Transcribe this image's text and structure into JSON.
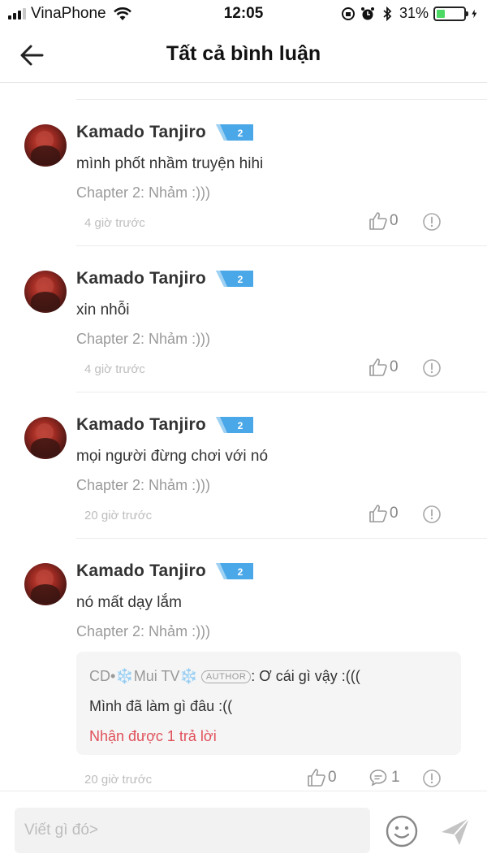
{
  "status_bar": {
    "carrier": "VinaPhone",
    "time": "12:05",
    "battery_percent": "31%",
    "battery_level": 0.31,
    "battery_color": "#4cd964"
  },
  "nav": {
    "back_icon": "arrow-left-icon",
    "title": "Tất cả bình luận"
  },
  "comments": [
    {
      "author": "Kamado Tanjiro",
      "level": "2",
      "text": "mình phốt nhầm truyện hihi",
      "chapter": "Chapter 2: Nhảm :)))",
      "time": "4 giờ trước",
      "likes": "0"
    },
    {
      "author": "Kamado Tanjiro",
      "level": "2",
      "text": "xin nhỗi",
      "chapter": "Chapter 2: Nhảm :)))",
      "time": "4 giờ trước",
      "likes": "0"
    },
    {
      "author": "Kamado Tanjiro",
      "level": "2",
      "text": "mọi người đừng chơi với nó",
      "chapter": "Chapter 2: Nhảm :)))",
      "time": "20 giờ trước",
      "likes": "0"
    },
    {
      "author": "Kamado Tanjiro",
      "level": "2",
      "text": "nó mất dạy lắm",
      "chapter": "Chapter 2: Nhảm :)))",
      "time": "20 giờ trước",
      "likes": "0",
      "replies": "1",
      "reply_preview": {
        "author": "CD•❄️Mui TV❄️",
        "badge": "AUTHOR",
        "text": ": Ơ cái gì vậy :(((",
        "text2": "Mình đã làm gì đâu :((",
        "link": "Nhận được 1 trả lời"
      }
    }
  ],
  "input": {
    "placeholder": "Viết gì đó>",
    "emoji_icon": "emoji-icon",
    "send_icon": "send-icon"
  },
  "colors": {
    "badge_blue": "#4aa8e8",
    "link_red": "#e0505a"
  }
}
